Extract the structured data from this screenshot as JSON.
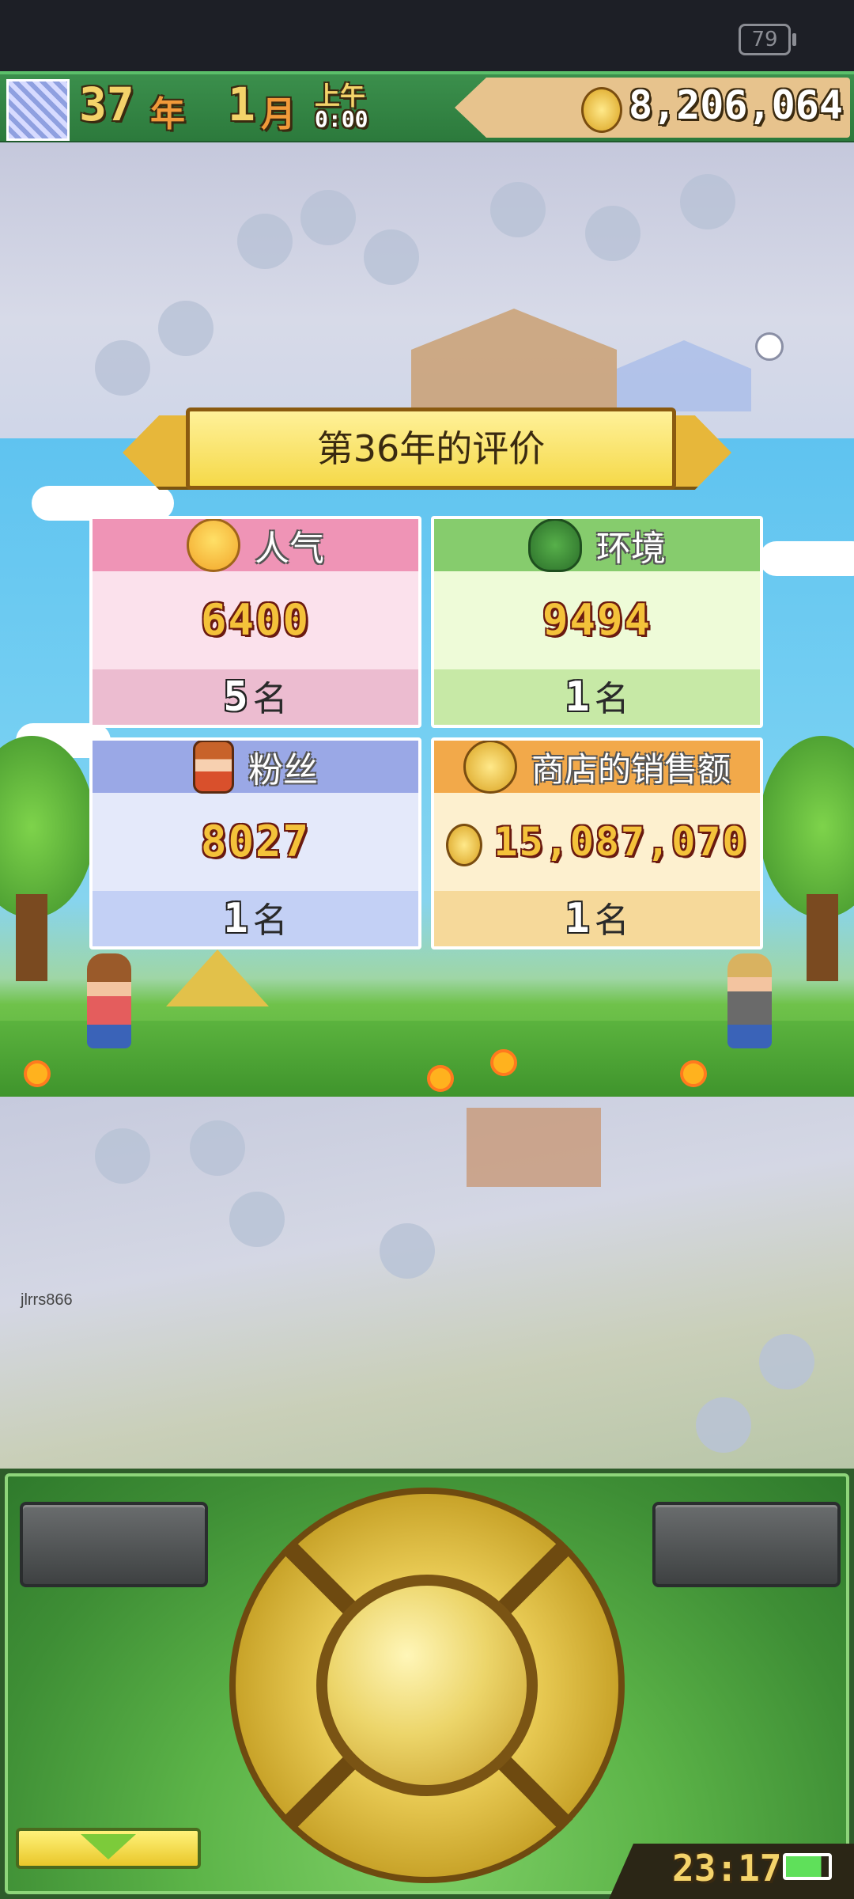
{
  "status_bar": {
    "battery_level": "79"
  },
  "hud": {
    "year": "37",
    "year_unit": "年",
    "month": "1",
    "month_unit": "月",
    "period": "上午",
    "time": "0:00",
    "money": "8,206,064"
  },
  "evaluation": {
    "title": "第36年的评价",
    "cards": [
      {
        "label": "人气",
        "value": "6400",
        "rank": "5",
        "rank_unit": "名",
        "icon": "smile-face-icon"
      },
      {
        "label": "环境",
        "value": "9494",
        "rank": "1",
        "rank_unit": "名",
        "icon": "tree-icon"
      },
      {
        "label": "粉丝",
        "value": "8027",
        "rank": "1",
        "rank_unit": "名",
        "icon": "girl-icon"
      },
      {
        "label": "商店的销售额",
        "value": "15,087,070",
        "rank": "1",
        "rank_unit": "名",
        "icon": "coin-icon"
      }
    ]
  },
  "watermark": "jlrrs866",
  "controller": {
    "clock": "23:17",
    "battery": "battery-icon"
  },
  "colors": {
    "popularity": "#ef94b6",
    "environment": "#86cc6d",
    "fans": "#9aa8e6",
    "sales": "#f2a94a",
    "banner": "#f5d949",
    "controller_green": "#5cb448",
    "dpad_gold": "#e9cb55"
  }
}
